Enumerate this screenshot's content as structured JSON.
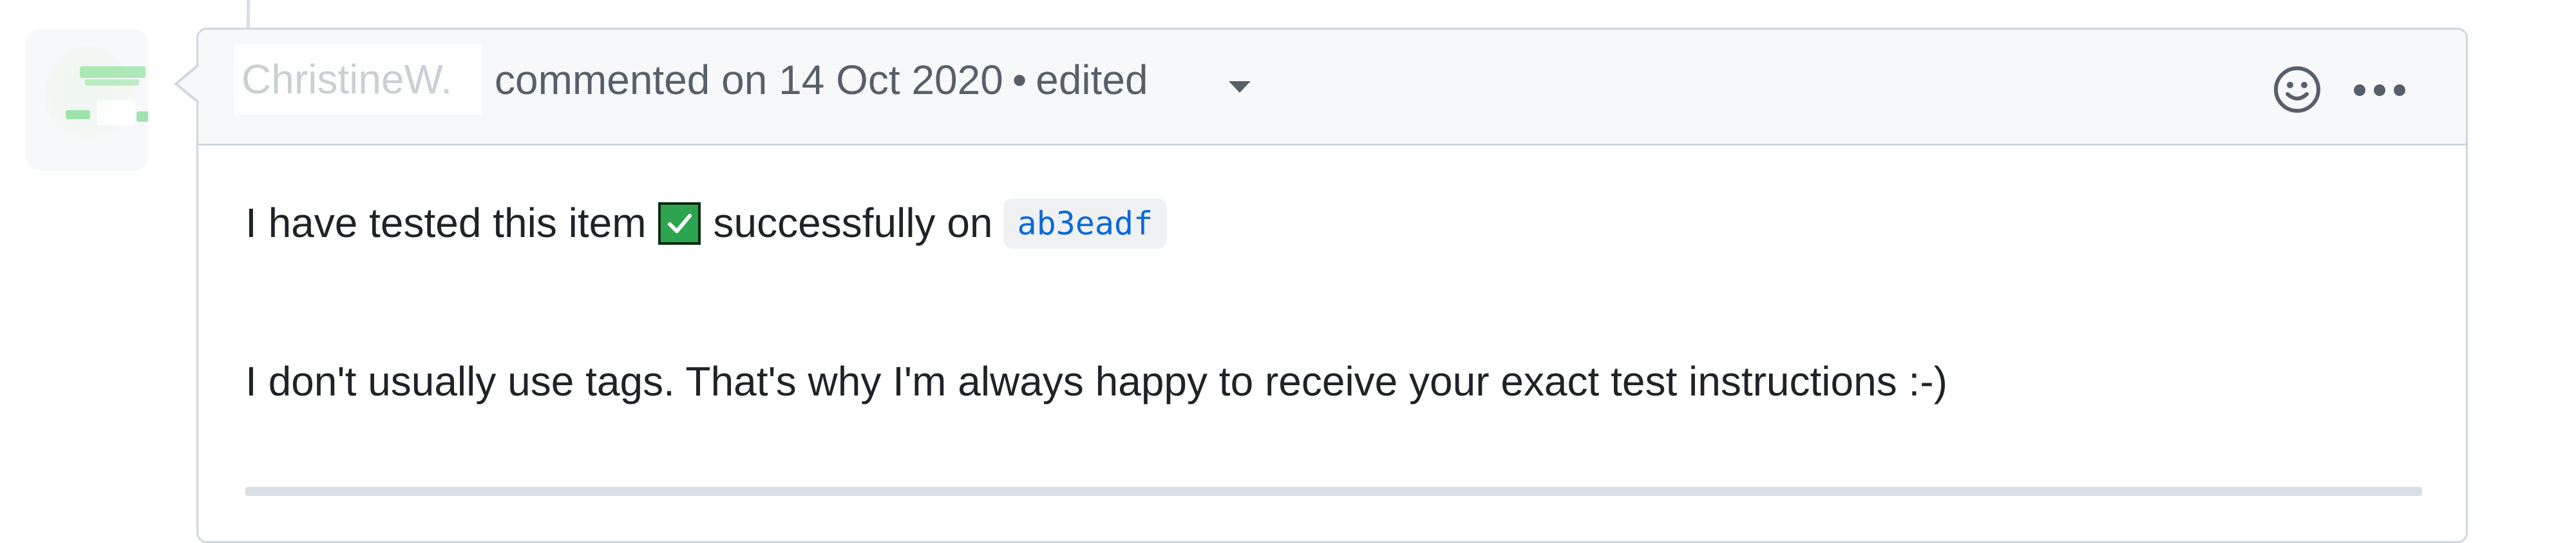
{
  "comment": {
    "author": "ChristineW.",
    "action_text": "commented on 14 Oct 2020",
    "separator": "•",
    "edited_label": "edited",
    "icons": {
      "edited_menu": "chevron-down-icon",
      "reaction": "smiley-icon",
      "more": "kebab-horizontal-icon",
      "inline_emoji": "white-check-mark-icon"
    },
    "body": {
      "line1_before": "I have tested this item",
      "line1_after": "successfully on",
      "commit_sha": "ab3eadf",
      "line2": "I don't usually use tags. That's why I'm always happy to receive your exact test instructions :-)"
    }
  },
  "colors": {
    "border": "#d0d7de",
    "header_bg": "#f6f8fa",
    "muted_text": "#57606a",
    "link": "#0969da",
    "check_green": "#2da44e"
  }
}
